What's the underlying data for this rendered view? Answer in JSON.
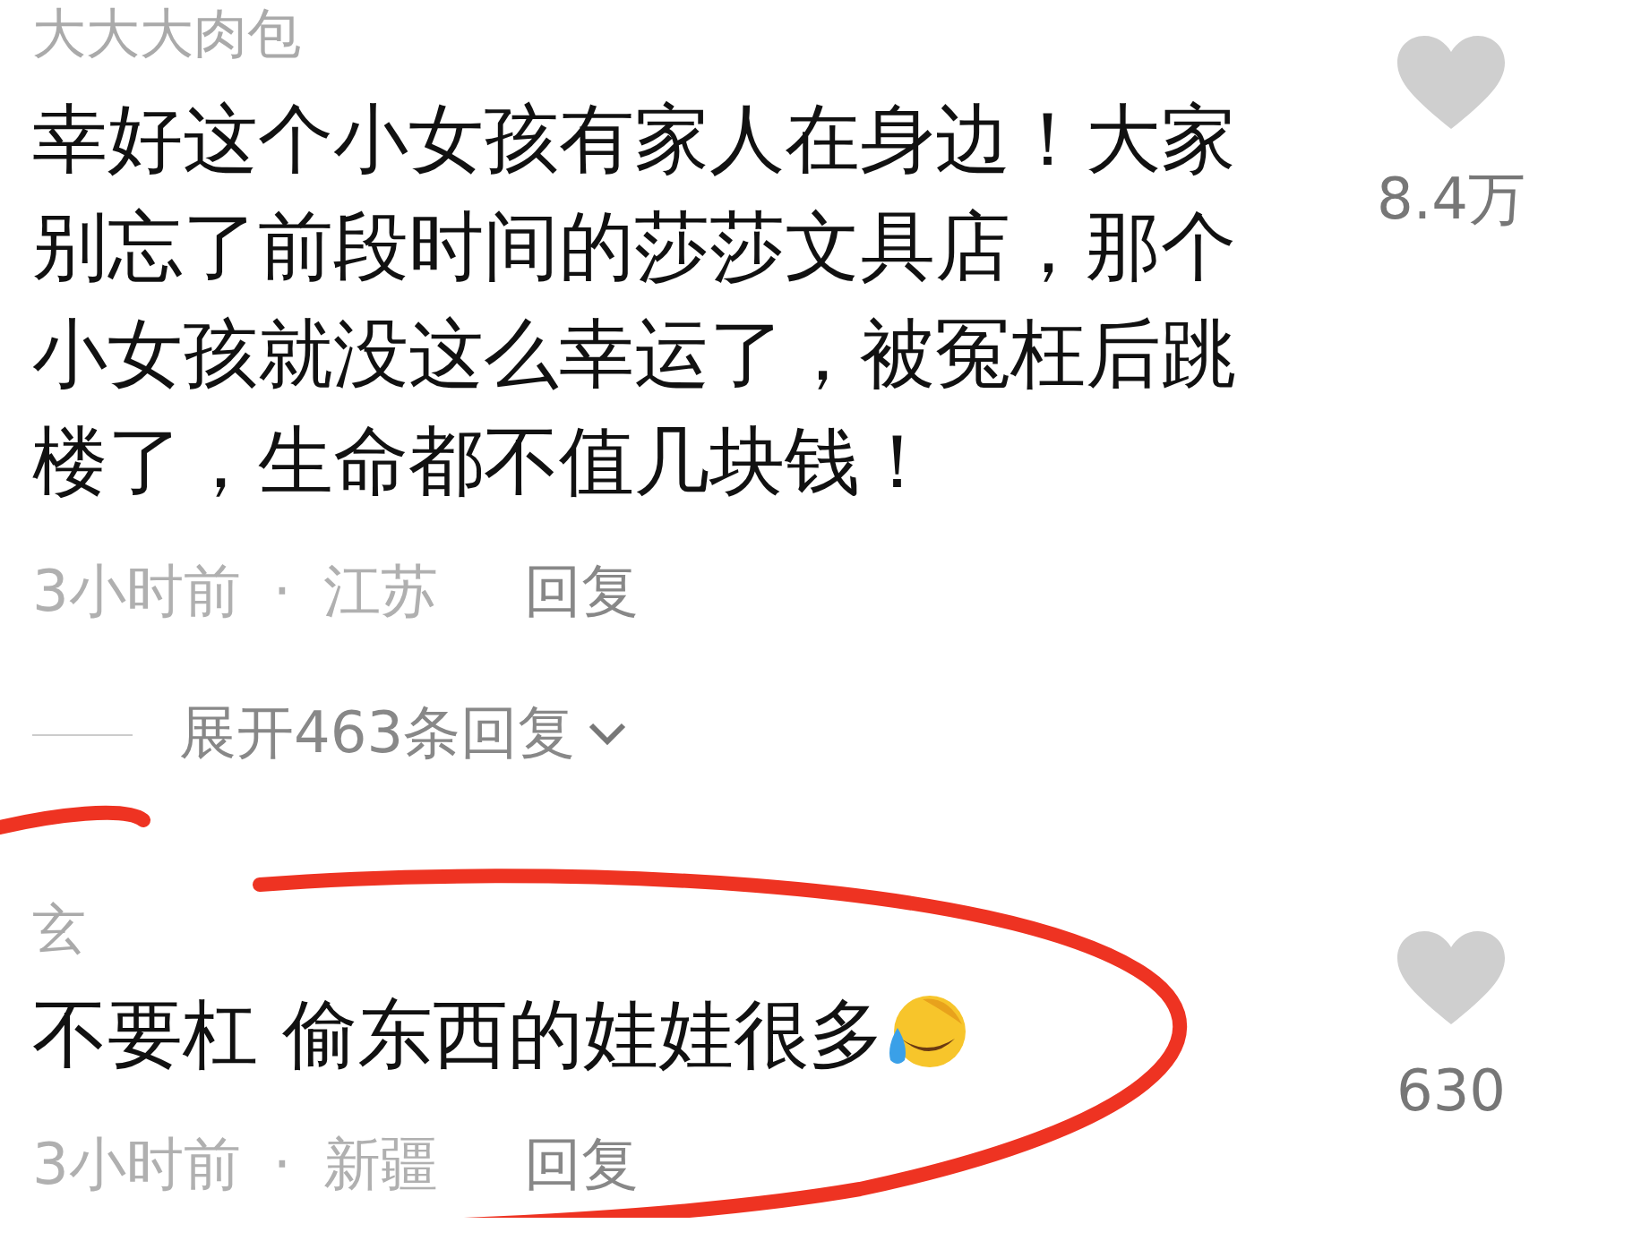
{
  "comments": [
    {
      "author": "大大大肉包",
      "text": "幸好这个小女孩有家人在身边！大家别忘了前段时间的莎莎文具店，那个小女孩就没这么幸运了，被冤枉后跳楼了，生命都不值几块钱！",
      "emoji": false,
      "time": "3小时前",
      "separator": "·",
      "location": "江苏",
      "reply": "回复",
      "likes": "8.4万",
      "expand": "展开463条回复"
    },
    {
      "author": "玄",
      "text": "不要杠  偷东西的娃娃很多",
      "emoji": true,
      "time": "3小时前",
      "separator": "·",
      "location": "新疆",
      "reply": "回复",
      "likes": "630"
    }
  ]
}
